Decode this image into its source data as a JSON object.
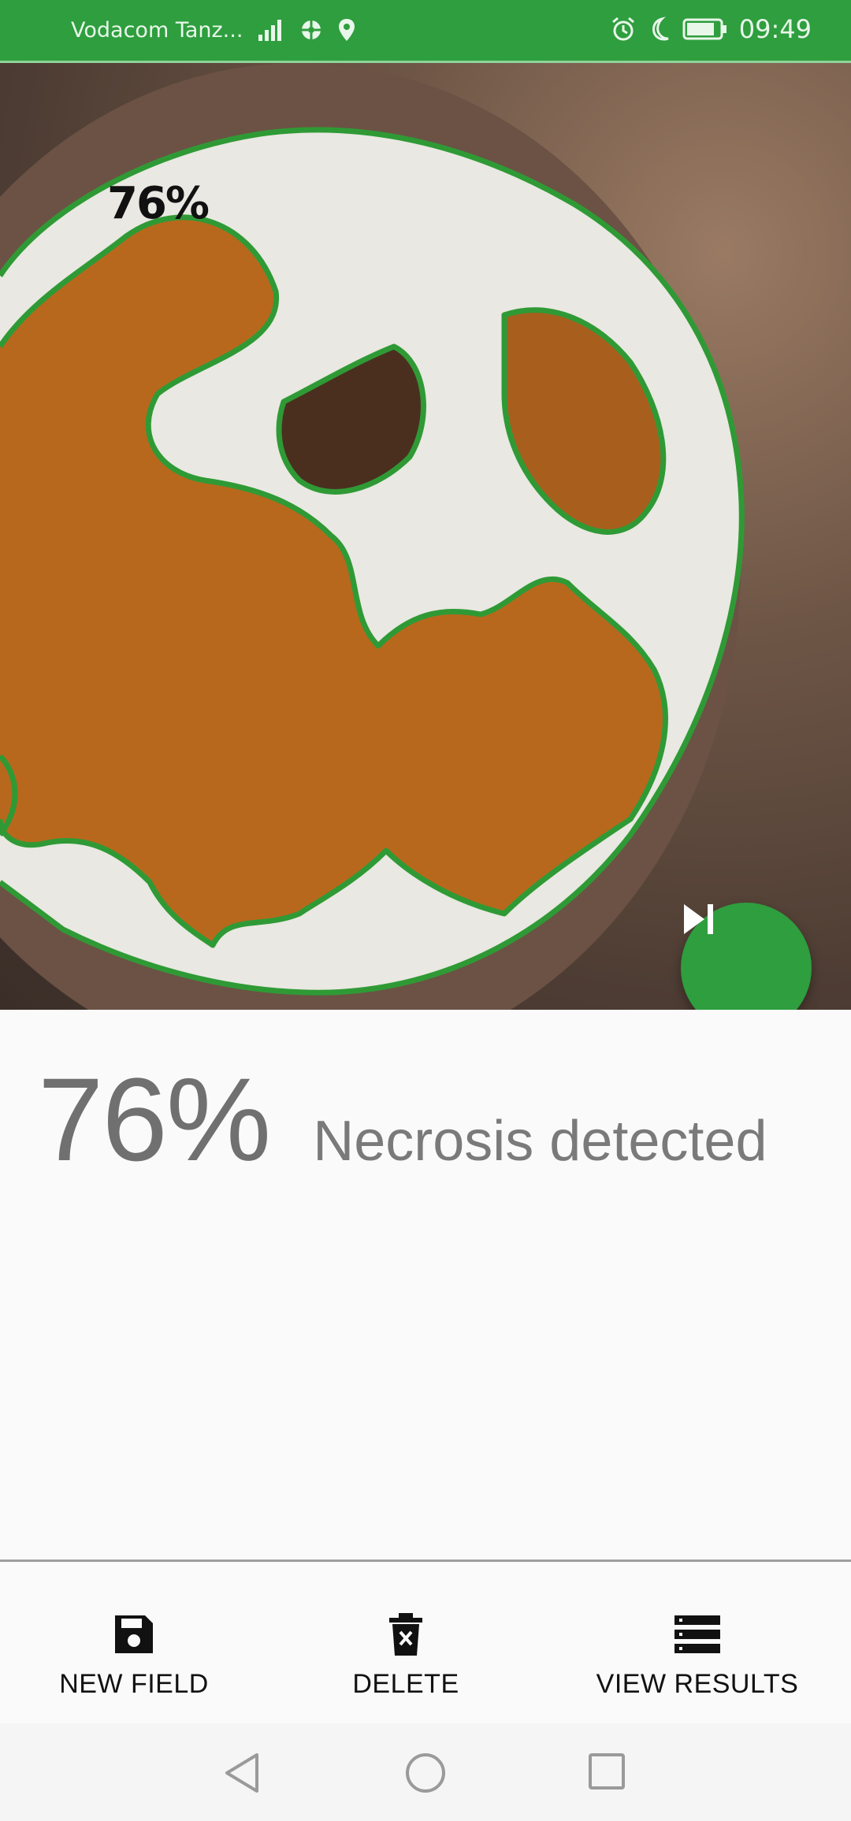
{
  "status_bar": {
    "carrier": "Vodacom Tanz...",
    "time": "09:49",
    "left_icons": [
      "signal-icon",
      "data-saver-icon",
      "location-icon"
    ],
    "right_icons": [
      "alarm-icon",
      "moon-icon",
      "battery-icon"
    ],
    "color": "#2e9e3e"
  },
  "photo": {
    "overlay_label": "76%",
    "outline_color": "#2f9a35"
  },
  "result": {
    "percent": "76%",
    "label": "Necrosis detected"
  },
  "actions": [
    {
      "label": "NEW FIELD",
      "icon": "save-icon"
    },
    {
      "label": "DELETE",
      "icon": "delete-icon"
    },
    {
      "label": "VIEW RESULTS",
      "icon": "list-icon"
    }
  ],
  "fab": {
    "icon": "skip-next-icon",
    "color": "#2e9e3e"
  },
  "nav": {
    "icons": [
      "back-icon",
      "home-icon",
      "recents-icon"
    ]
  }
}
